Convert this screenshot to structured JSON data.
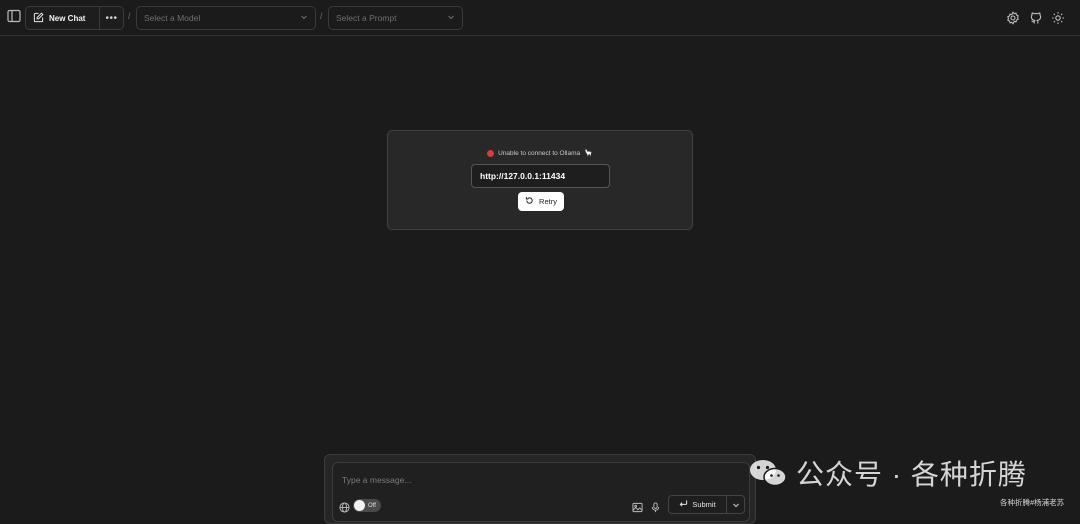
{
  "header": {
    "new_chat_label": "New Chat",
    "more_label": "•••",
    "separator": "/",
    "model_select": {
      "placeholder": "Select a Model"
    },
    "prompt_select": {
      "placeholder": "Select a Prompt"
    },
    "icons": [
      "sidebar-toggle-icon",
      "new-chat-edit-icon",
      "chevron-down-icon",
      "settings-icon",
      "github-icon",
      "gear-icon"
    ]
  },
  "connection": {
    "status_text": "Unable to connect to Ollama",
    "status_emoji": "🦙",
    "status_color": "#d93a3a",
    "url_value": "http://127.0.0.1:11434",
    "retry_label": "Retry"
  },
  "composer": {
    "placeholder": "Type a message...",
    "web_toggle_label": "Off",
    "submit_label": "Submit"
  },
  "watermark": {
    "main_text": "公众号 · 各种折腾",
    "small_text": "各种折腾#杨浦老苏"
  }
}
